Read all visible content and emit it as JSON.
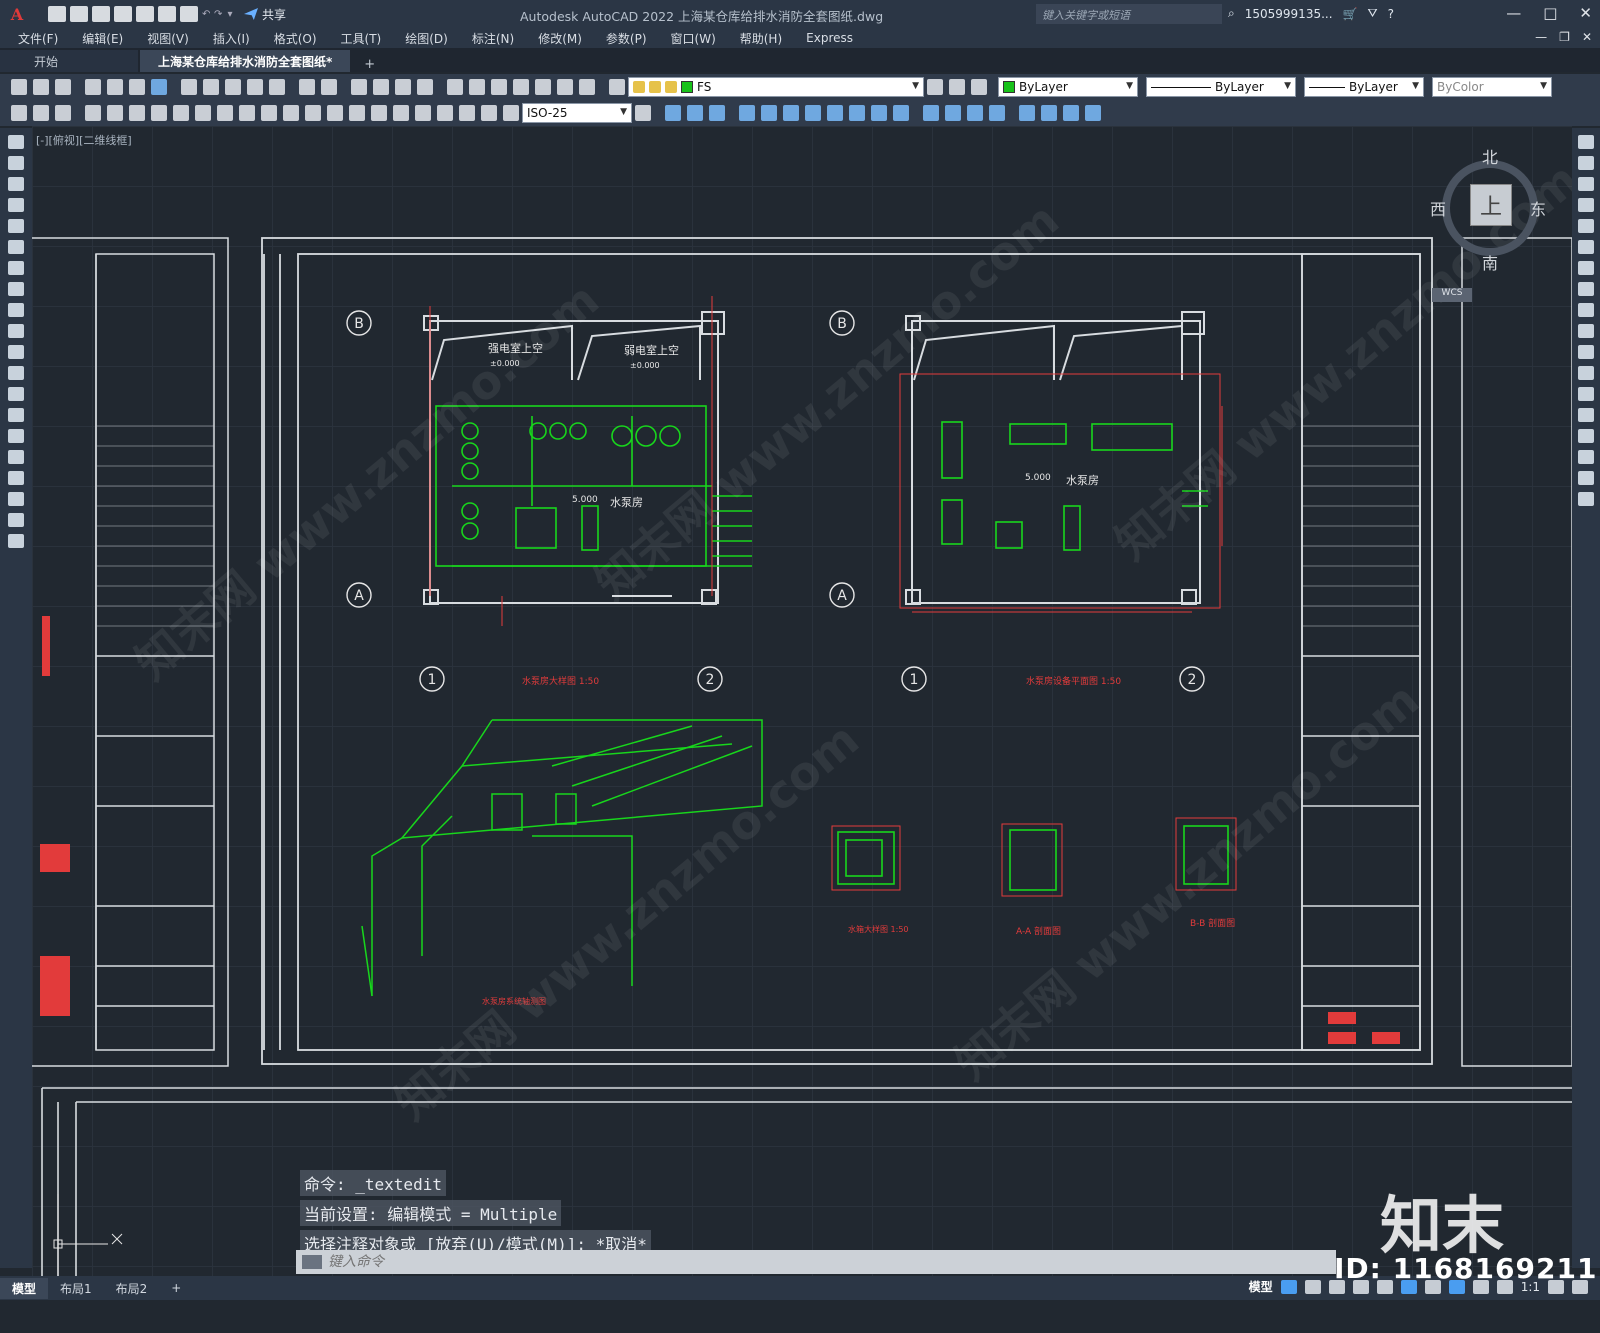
{
  "titlebar": {
    "share_label": "共享",
    "title": "Autodesk AutoCAD 2022    上海某仓库给排水消防全套图纸.dwg",
    "search_placeholder": "键入关键字或短语",
    "user": "1505999135...",
    "window_controls": [
      "—",
      "□",
      "✕"
    ]
  },
  "menubar": {
    "items": [
      "文件(F)",
      "编辑(E)",
      "视图(V)",
      "插入(I)",
      "格式(O)",
      "工具(T)",
      "绘图(D)",
      "标注(N)",
      "修改(M)",
      "参数(P)",
      "窗口(W)",
      "帮助(H)",
      "Express"
    ]
  },
  "tabs": {
    "items": [
      {
        "label": "开始"
      },
      {
        "label": "上海某仓库给排水消防全套图纸*"
      }
    ],
    "add": "+"
  },
  "properties": {
    "layer": "FS",
    "color": "ByLayer",
    "linetype": "ByLayer",
    "lineweight": "ByLayer",
    "plotstyle": "ByColor",
    "dimstyle": "ISO-25",
    "layer_color": "#18c21a",
    "color_swatch": "#18c21a"
  },
  "canvas": {
    "viewport_label": "[-][俯视][二维线框]",
    "watermark_text": "知末网 www.znzmo.com",
    "drawing": {
      "plan1": {
        "title": "水泵房大样图 1:50",
        "room_label": "水泵房",
        "level": "5.000",
        "upper_left": "强电室上空",
        "upper_right": "弱电室上空",
        "upper_level": "±0.000",
        "axis": [
          "B",
          "A",
          "1",
          "2"
        ]
      },
      "plan2": {
        "title": "水泵房设备平面图 1:50",
        "room_label": "水泵房",
        "level": "5.000",
        "axis": [
          "B",
          "A",
          "1",
          "2"
        ]
      },
      "iso_title": "水泵房系统轴测图",
      "detail_titles": [
        "水箱大样图 1:50",
        "A-A 剖面图",
        "B-B 剖面图"
      ]
    }
  },
  "viewcube": {
    "north": "北",
    "south": "南",
    "east": "东",
    "west": "西",
    "face": "上",
    "wcs": "WCS"
  },
  "command": {
    "history": [
      "命令: _textedit",
      "当前设置: 编辑模式 = Multiple",
      "选择注释对象或 [放弃(U)/模式(M)]: *取消*"
    ],
    "placeholder": "键入命令"
  },
  "statusbar": {
    "layout_tabs": [
      "模型",
      "布局1",
      "布局2"
    ],
    "add": "+",
    "model_label": "模型",
    "scale": "1:1"
  },
  "brand": {
    "logo_text": "知末",
    "id_text": "ID: 1168169211"
  }
}
